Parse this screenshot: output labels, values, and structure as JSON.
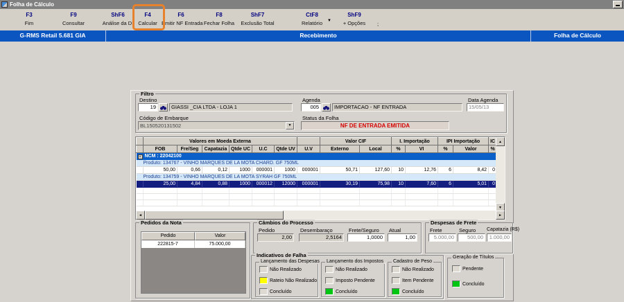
{
  "window": {
    "title": "Folha de Cálculo"
  },
  "toolbar": {
    "items": [
      {
        "key": "F3",
        "label": "Fim"
      },
      {
        "key": "F9",
        "label": "Consultar"
      },
      {
        "key": "ShF6",
        "label": "Análise da DI"
      },
      {
        "key": "F4",
        "label": "Calcular",
        "highlighted": true
      },
      {
        "key": "F6",
        "label": "Emitir NF Entrada"
      },
      {
        "key": "F8",
        "label": "Fechar Folha"
      },
      {
        "key": "ShF7",
        "label": "Exclusão Total"
      },
      {
        "key": "CtF8",
        "label": "Relatório"
      },
      {
        "key": "ShF9",
        "label": "+ Opções"
      }
    ],
    "extra": ";",
    "caret": "▼",
    "highlight_color": "#e8812b"
  },
  "statusbar": {
    "left": "G-RMS Retail 5.681 GIA",
    "center": "Recebimento",
    "right": "Folha de Cálculo",
    "color": "#0a55c0"
  },
  "filter": {
    "legend": "Filtro",
    "destino": {
      "label": "Destino",
      "code": "19",
      "name": "GIASSI _CIA LTDA - LOJA 1"
    },
    "agenda": {
      "label": "Agenda",
      "code": "005",
      "name": "IMPORTACAO - NF ENTRADA"
    },
    "data_agenda": {
      "label": "Data Agenda",
      "value": "15/05/13"
    },
    "codigo_embarque": {
      "label": "Código de Embarque",
      "value": "BL150520131502"
    },
    "status_folha": {
      "label": "Status da Folha",
      "value": "NF DE ENTRADA EMITIDA",
      "color": "#d40000"
    }
  },
  "grid": {
    "group_headers": [
      "Valores em Moeda Externa",
      "",
      "Valor CIF",
      "I. Importação",
      "IPI Importação",
      "IC"
    ],
    "columns": [
      "FOB",
      "Fre/Seg",
      "Capatazia",
      "Qtde UC",
      "U.C",
      "Qtde UV",
      "U.V",
      "Externo",
      "Local",
      "%",
      "VI",
      "%",
      "Valor",
      "%"
    ],
    "ncm": "NCM : 22042100",
    "products": [
      {
        "name": "Produto: 134767 - VINHO MARQUES DE LA MOTA CHARD. GF 750ML",
        "values": [
          "50,00",
          "0,66",
          "0,12",
          "1000",
          "000001",
          "1000",
          "000001",
          "50,71",
          "127,60",
          "10",
          "12,76",
          "6",
          "8,42",
          "0"
        ]
      },
      {
        "name": "Produto: 134759 - VINHO MARQUES DE LA MOTA SYRAH GF 750ML",
        "values": [
          "25,00",
          "4,84",
          "0,88",
          "1000",
          "000012",
          "12000",
          "000001",
          "30,19",
          "75,98",
          "10",
          "7,60",
          "6",
          "5,01",
          "0"
        ],
        "selected": true
      }
    ],
    "selected_row_color": "#141d80",
    "ncm_row_color": "#0a60c8",
    "product_row_color": "#d4e8fa"
  },
  "pedidos": {
    "legend": "Pedidos da Nota",
    "columns": [
      "Pedido",
      "Valor"
    ],
    "rows": [
      [
        "222815-7",
        "75.000,00"
      ]
    ]
  },
  "cambios": {
    "legend": "Câmbios do Processo",
    "fields": [
      {
        "label": "Pedido",
        "value": "2,00"
      },
      {
        "label": "Desembaraço",
        "value": "2,5164"
      },
      {
        "label": "Frete/Seguro",
        "value": "1,0000"
      },
      {
        "label": "Atual",
        "value": "1,00"
      }
    ]
  },
  "despesas": {
    "legend": "Despesas de Frete",
    "fields": [
      {
        "label": "Frete",
        "value": "5.000,00"
      },
      {
        "label": "Seguro",
        "value": "500,00"
      },
      {
        "label": "Capatazia (R$)",
        "value": "1.000,00"
      }
    ]
  },
  "indicativos": {
    "legend": "Indicativos de Falha",
    "groups": [
      {
        "legend": "Lançamento das Despesas",
        "items": [
          {
            "label": "Não Realizado",
            "color": "#dedad2"
          },
          {
            "label": "Rateio Não Realizado",
            "color": "#ffff00"
          },
          {
            "label": "Concluído",
            "color": "#dedad2"
          }
        ]
      },
      {
        "legend": "Lançamento dos Impostos",
        "items": [
          {
            "label": "Não Realizado",
            "color": "#dedad2"
          },
          {
            "label": "Imposto Pendente",
            "color": "#dedad2"
          },
          {
            "label": "Concluído",
            "color": "#00c613"
          }
        ]
      },
      {
        "legend": "Cadastro de Peso",
        "items": [
          {
            "label": "Não Realizado",
            "color": "#dedad2"
          },
          {
            "label": "Item Pendente",
            "color": "#dedad2"
          },
          {
            "label": "Concluído",
            "color": "#00c613"
          }
        ]
      }
    ]
  },
  "geracao": {
    "legend": "Geração de Títulos",
    "items": [
      {
        "label": "Pendente",
        "color": "#dedad2"
      },
      {
        "label": "Concluído",
        "color": "#00c613"
      }
    ]
  }
}
